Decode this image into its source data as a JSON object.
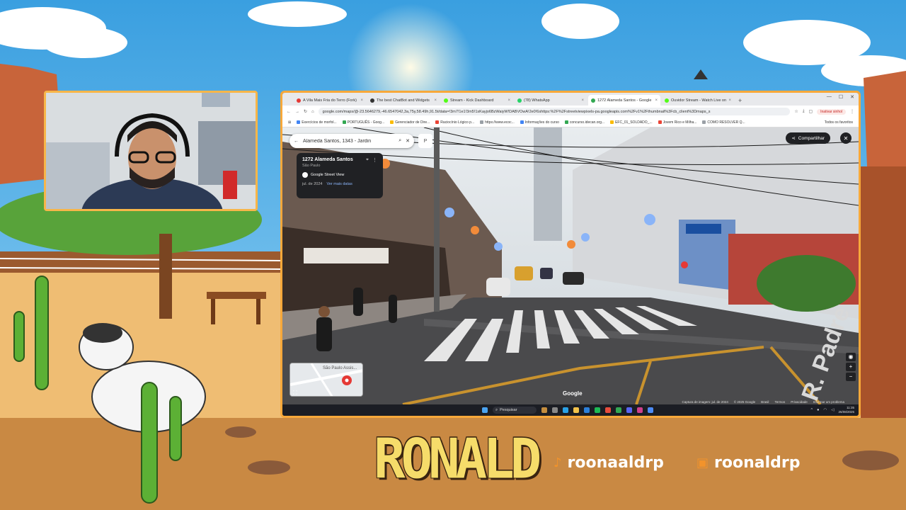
{
  "overlay": {
    "logo_text": "RONALD",
    "socials": [
      {
        "platform": "tiktok-icon",
        "handle": "roonaaldrp"
      },
      {
        "platform": "twitch-icon",
        "handle": "roonaldrp"
      }
    ],
    "accent_color": "#f7a83a"
  },
  "browser": {
    "tabs": [
      {
        "label": "A Vila Mais Fria do Terro (Fork)",
        "color": "#e53935",
        "active": false
      },
      {
        "label": "The best ChatBot and Widgets",
        "color": "#333333",
        "active": false
      },
      {
        "label": "Stream - Kick Dashboard",
        "color": "#53fc18",
        "active": false
      },
      {
        "label": "(78) WhatsApp",
        "color": "#25d366",
        "active": false
      },
      {
        "label": "1272 Alameda Santos - Google",
        "color": "#34a853",
        "active": true
      },
      {
        "label": "Ouvidor Stream - Watch Live on",
        "color": "#53fc18",
        "active": false
      }
    ],
    "new_tab": "+",
    "url": "google.com/maps/@-23.5646279,-46.6547042,3a,75y,58.49h,91.5t/data=!3m7!1e1!3m5!1sKayjo6BzWaiyW!DABVOwA!2e0!6shttps:%2F%2Fstreetviewpixels-pa.googleapis.com%2Fv1%2Fthumbnail%3Fcb_client%3Dmaps_s",
    "incognito_label": "Inativar sinhol",
    "bookmarks": [
      "Exercícios de morfol...",
      "PORTUGUÊS - Goog...",
      "Gerenciador de Dire...",
      "Raciocínio Lógico p...",
      "https://www.ecoc...",
      "Informações do curso",
      "concurso.idecan.org...",
      "EFC_01_SOLDADO_...",
      "Jovem Rico e Milha...",
      "COMO RESOLVER Q..."
    ],
    "bookmarks_all": "Todos os favoritos"
  },
  "maps": {
    "search_value": "Alameda Santos, 1343 - Jardin",
    "p_button": "P",
    "card_title": "1272 Alameda Santos",
    "card_subtitle": "São Paulo",
    "card_source": "Google Street View",
    "card_date": "jul. de 2024",
    "card_more_dates": "Ver mais datas",
    "share_label": "Compartilhar",
    "minimap_label": "São Paulo Assis...",
    "watermark": "Google",
    "street_sign": "R. Padre",
    "footer": [
      "Captura de imagem: jul. de 2024",
      "© 2025 Google",
      "Brasil",
      "Termos",
      "Privacidade",
      "Informar um problema"
    ]
  },
  "taskbar": {
    "search_label": "Pesquisar",
    "time": "11:35",
    "date": "26/08/2025"
  }
}
